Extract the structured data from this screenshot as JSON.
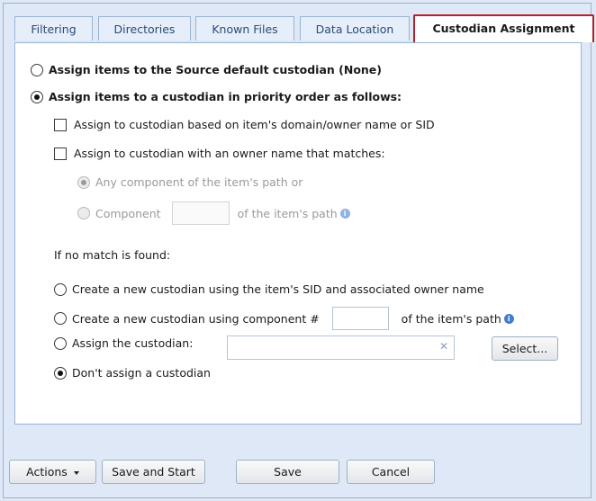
{
  "tabs": [
    {
      "label": "Filtering"
    },
    {
      "label": "Directories"
    },
    {
      "label": "Known Files"
    },
    {
      "label": "Data Location"
    },
    {
      "label": "Custodian Assignment",
      "active": true
    }
  ],
  "options": {
    "source_default": "Assign items to the Source default custodian (None)",
    "priority_order": "Assign items to a custodian in priority order as follows:",
    "by_domain": "Assign to custodian based on item's domain/owner name or SID",
    "by_owner_match": "Assign to custodian with an owner name that matches:",
    "any_component": "Any component of the item's path or",
    "component": "Component",
    "component_suffix": "of the item's path",
    "component_value": ""
  },
  "no_match": {
    "heading": "If no match is found:",
    "create_sid": "Create a new custodian using the item's SID and associated owner name",
    "create_component": "Create a new custodian using component #",
    "create_component_suffix": "of the item's path",
    "component_number": "",
    "assign_custodian": "Assign the custodian:",
    "custodian_value": "",
    "select_label": "Select...",
    "dont_assign": "Don't assign a custodian",
    "selected": "dont_assign"
  },
  "footer": {
    "actions": "Actions",
    "save_start": "Save and Start",
    "save": "Save",
    "cancel": "Cancel"
  },
  "colors": {
    "active_tab_border": "#b8202a",
    "info_icon": "#3f7fd0"
  }
}
